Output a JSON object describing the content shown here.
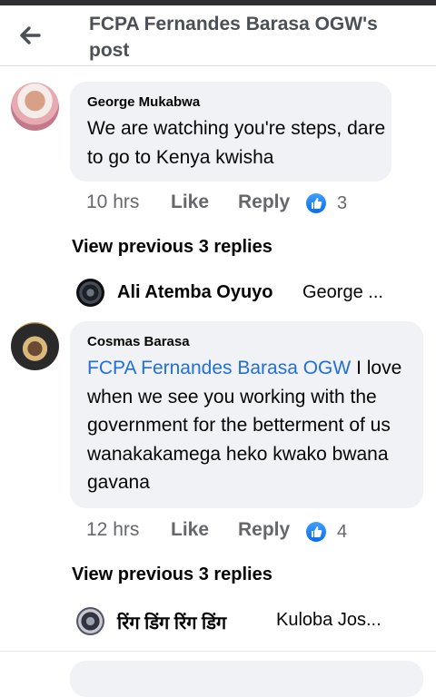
{
  "header": {
    "title": "FCPA Fernandes Barasa OGW's post",
    "back_icon": "arrow-left-icon"
  },
  "comments": [
    {
      "author": "George Mukabwa",
      "text": "We are watching you're steps, dare to go to Kenya kwisha",
      "time": "10 hrs",
      "like_label": "Like",
      "reply_label": "Reply",
      "reaction_count": "3",
      "view_previous": "View previous 3 replies",
      "latest_reply": {
        "name": "Ali Atemba Oyuyo",
        "snippet": "George ..."
      }
    },
    {
      "author": "Cosmas Barasa",
      "mention": "FCPA Fernandes Barasa OGW",
      "text_after_mention": "I love when we see you working with the government for the betterment of us wanakakamega heko kwako bwana gavana",
      "time": "12 hrs",
      "like_label": "Like",
      "reply_label": "Reply",
      "reaction_count": "4",
      "view_previous": "View previous 3 replies",
      "latest_reply": {
        "name": "रिंग डिंग रिंग डिंग",
        "snippet": "Kuloba Jos..."
      }
    }
  ],
  "colors": {
    "mention": "#216fdb",
    "bubble": "#f0f2f5",
    "meta": "#65676b",
    "like_blue": "#1877f2"
  }
}
